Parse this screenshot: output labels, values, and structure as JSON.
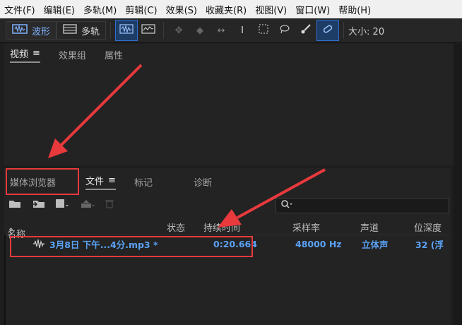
{
  "menu": [
    "文件(F)",
    "编辑(E)",
    "多轨(M)",
    "剪辑(C)",
    "效果(S)",
    "收藏夹(R)",
    "视图(V)",
    "窗口(W)",
    "帮助(H)"
  ],
  "toolbar": {
    "waveform_label": "波形",
    "multitrack_label": "多轨",
    "size_label": "大小: 20"
  },
  "top_panel": {
    "tabs": [
      "视频",
      "效果组",
      "属性"
    ]
  },
  "bottom_panel": {
    "tabs": [
      "媒体浏览器",
      "文件",
      "标记",
      "诊断"
    ]
  },
  "file_list": {
    "columns": [
      "名称",
      "状态",
      "持续时间",
      "采样率",
      "声道",
      "位深度"
    ],
    "rows": [
      {
        "name": "3月8日 下午...4分.mp3 *",
        "status": "",
        "duration": "0:20.664",
        "sample_rate": "48000 Hz",
        "channels": "立体声",
        "bit_depth": "32 (浮"
      }
    ]
  },
  "colors": {
    "accent": "#5aa2f5",
    "annotation_red": "#e8393c"
  }
}
